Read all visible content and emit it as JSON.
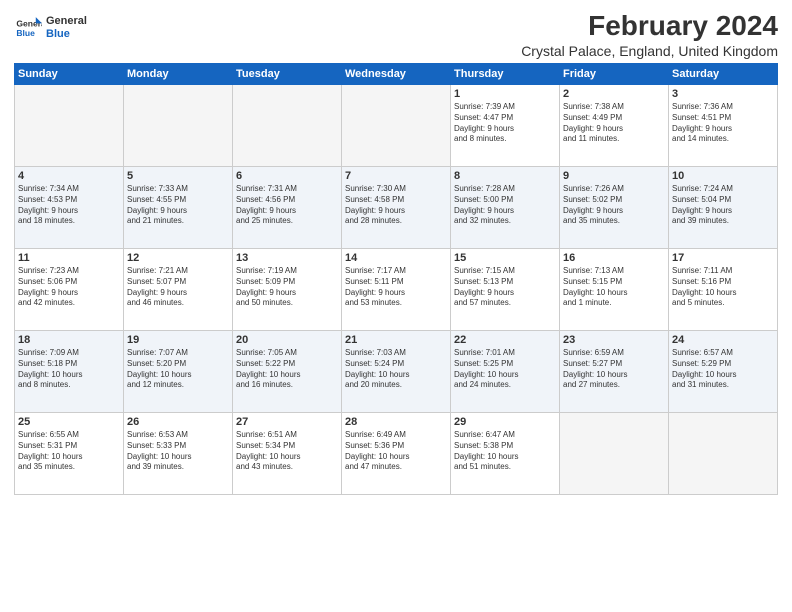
{
  "header": {
    "logo_line1": "General",
    "logo_line2": "Blue",
    "main_title": "February 2024",
    "subtitle": "Crystal Palace, England, United Kingdom"
  },
  "days_of_week": [
    "Sunday",
    "Monday",
    "Tuesday",
    "Wednesday",
    "Thursday",
    "Friday",
    "Saturday"
  ],
  "weeks": [
    [
      {
        "day": "",
        "content": ""
      },
      {
        "day": "",
        "content": ""
      },
      {
        "day": "",
        "content": ""
      },
      {
        "day": "",
        "content": ""
      },
      {
        "day": "1",
        "content": "Sunrise: 7:39 AM\nSunset: 4:47 PM\nDaylight: 9 hours\nand 8 minutes."
      },
      {
        "day": "2",
        "content": "Sunrise: 7:38 AM\nSunset: 4:49 PM\nDaylight: 9 hours\nand 11 minutes."
      },
      {
        "day": "3",
        "content": "Sunrise: 7:36 AM\nSunset: 4:51 PM\nDaylight: 9 hours\nand 14 minutes."
      }
    ],
    [
      {
        "day": "4",
        "content": "Sunrise: 7:34 AM\nSunset: 4:53 PM\nDaylight: 9 hours\nand 18 minutes."
      },
      {
        "day": "5",
        "content": "Sunrise: 7:33 AM\nSunset: 4:55 PM\nDaylight: 9 hours\nand 21 minutes."
      },
      {
        "day": "6",
        "content": "Sunrise: 7:31 AM\nSunset: 4:56 PM\nDaylight: 9 hours\nand 25 minutes."
      },
      {
        "day": "7",
        "content": "Sunrise: 7:30 AM\nSunset: 4:58 PM\nDaylight: 9 hours\nand 28 minutes."
      },
      {
        "day": "8",
        "content": "Sunrise: 7:28 AM\nSunset: 5:00 PM\nDaylight: 9 hours\nand 32 minutes."
      },
      {
        "day": "9",
        "content": "Sunrise: 7:26 AM\nSunset: 5:02 PM\nDaylight: 9 hours\nand 35 minutes."
      },
      {
        "day": "10",
        "content": "Sunrise: 7:24 AM\nSunset: 5:04 PM\nDaylight: 9 hours\nand 39 minutes."
      }
    ],
    [
      {
        "day": "11",
        "content": "Sunrise: 7:23 AM\nSunset: 5:06 PM\nDaylight: 9 hours\nand 42 minutes."
      },
      {
        "day": "12",
        "content": "Sunrise: 7:21 AM\nSunset: 5:07 PM\nDaylight: 9 hours\nand 46 minutes."
      },
      {
        "day": "13",
        "content": "Sunrise: 7:19 AM\nSunset: 5:09 PM\nDaylight: 9 hours\nand 50 minutes."
      },
      {
        "day": "14",
        "content": "Sunrise: 7:17 AM\nSunset: 5:11 PM\nDaylight: 9 hours\nand 53 minutes."
      },
      {
        "day": "15",
        "content": "Sunrise: 7:15 AM\nSunset: 5:13 PM\nDaylight: 9 hours\nand 57 minutes."
      },
      {
        "day": "16",
        "content": "Sunrise: 7:13 AM\nSunset: 5:15 PM\nDaylight: 10 hours\nand 1 minute."
      },
      {
        "day": "17",
        "content": "Sunrise: 7:11 AM\nSunset: 5:16 PM\nDaylight: 10 hours\nand 5 minutes."
      }
    ],
    [
      {
        "day": "18",
        "content": "Sunrise: 7:09 AM\nSunset: 5:18 PM\nDaylight: 10 hours\nand 8 minutes."
      },
      {
        "day": "19",
        "content": "Sunrise: 7:07 AM\nSunset: 5:20 PM\nDaylight: 10 hours\nand 12 minutes."
      },
      {
        "day": "20",
        "content": "Sunrise: 7:05 AM\nSunset: 5:22 PM\nDaylight: 10 hours\nand 16 minutes."
      },
      {
        "day": "21",
        "content": "Sunrise: 7:03 AM\nSunset: 5:24 PM\nDaylight: 10 hours\nand 20 minutes."
      },
      {
        "day": "22",
        "content": "Sunrise: 7:01 AM\nSunset: 5:25 PM\nDaylight: 10 hours\nand 24 minutes."
      },
      {
        "day": "23",
        "content": "Sunrise: 6:59 AM\nSunset: 5:27 PM\nDaylight: 10 hours\nand 27 minutes."
      },
      {
        "day": "24",
        "content": "Sunrise: 6:57 AM\nSunset: 5:29 PM\nDaylight: 10 hours\nand 31 minutes."
      }
    ],
    [
      {
        "day": "25",
        "content": "Sunrise: 6:55 AM\nSunset: 5:31 PM\nDaylight: 10 hours\nand 35 minutes."
      },
      {
        "day": "26",
        "content": "Sunrise: 6:53 AM\nSunset: 5:33 PM\nDaylight: 10 hours\nand 39 minutes."
      },
      {
        "day": "27",
        "content": "Sunrise: 6:51 AM\nSunset: 5:34 PM\nDaylight: 10 hours\nand 43 minutes."
      },
      {
        "day": "28",
        "content": "Sunrise: 6:49 AM\nSunset: 5:36 PM\nDaylight: 10 hours\nand 47 minutes."
      },
      {
        "day": "29",
        "content": "Sunrise: 6:47 AM\nSunset: 5:38 PM\nDaylight: 10 hours\nand 51 minutes."
      },
      {
        "day": "",
        "content": ""
      },
      {
        "day": "",
        "content": ""
      }
    ]
  ]
}
